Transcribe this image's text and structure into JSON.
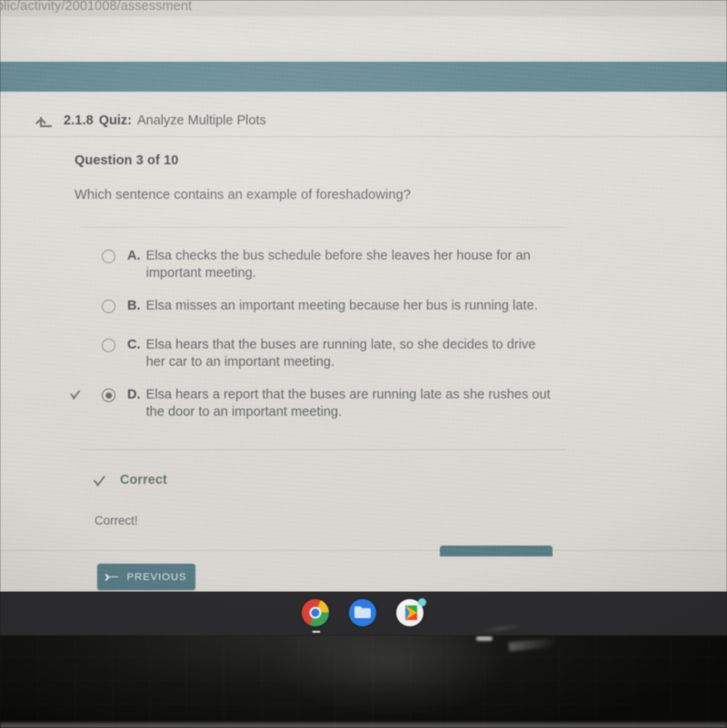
{
  "browser": {
    "url_fragment": "blic/activity/2001008/assessment"
  },
  "quiz_header": {
    "return_icon": "return-arrow-icon",
    "number": "2.1.8",
    "label": "Quiz:",
    "title": "Analyze Multiple Plots"
  },
  "question": {
    "counter": "Question 3 of 10",
    "prompt": "Which sentence contains an example of foreshadowing?",
    "options": [
      {
        "letter": "A.",
        "text": "Elsa checks the bus schedule before she leaves her house for an important meeting.",
        "selected": false
      },
      {
        "letter": "B.",
        "text": "Elsa misses an important meeting because her bus is running late.",
        "selected": false
      },
      {
        "letter": "C.",
        "text": "Elsa hears that the buses are running late, so she decides to drive her car to an important meeting.",
        "selected": false
      },
      {
        "letter": "D.",
        "text": "Elsa hears a report that the buses are running late as she rushes out the door to an important meeting.",
        "selected": true
      }
    ]
  },
  "feedback": {
    "status_icon": "checkmark-icon",
    "status": "Correct",
    "message": "Correct!"
  },
  "navigation": {
    "previous_label": "PREVIOUS",
    "previous_icon": "arrow-left-icon",
    "next_label": ""
  },
  "shelf": {
    "items": [
      {
        "icon": "chrome-icon"
      },
      {
        "icon": "files-folder-icon"
      },
      {
        "icon": "play-store-icon"
      }
    ]
  },
  "colors": {
    "appbar_teal": "#5b8b96",
    "button_teal": "#4e7f8b",
    "correct_green": "#62755e",
    "page_bg": "#e7e4dd",
    "shelf_bg": "#2c2c2e"
  }
}
